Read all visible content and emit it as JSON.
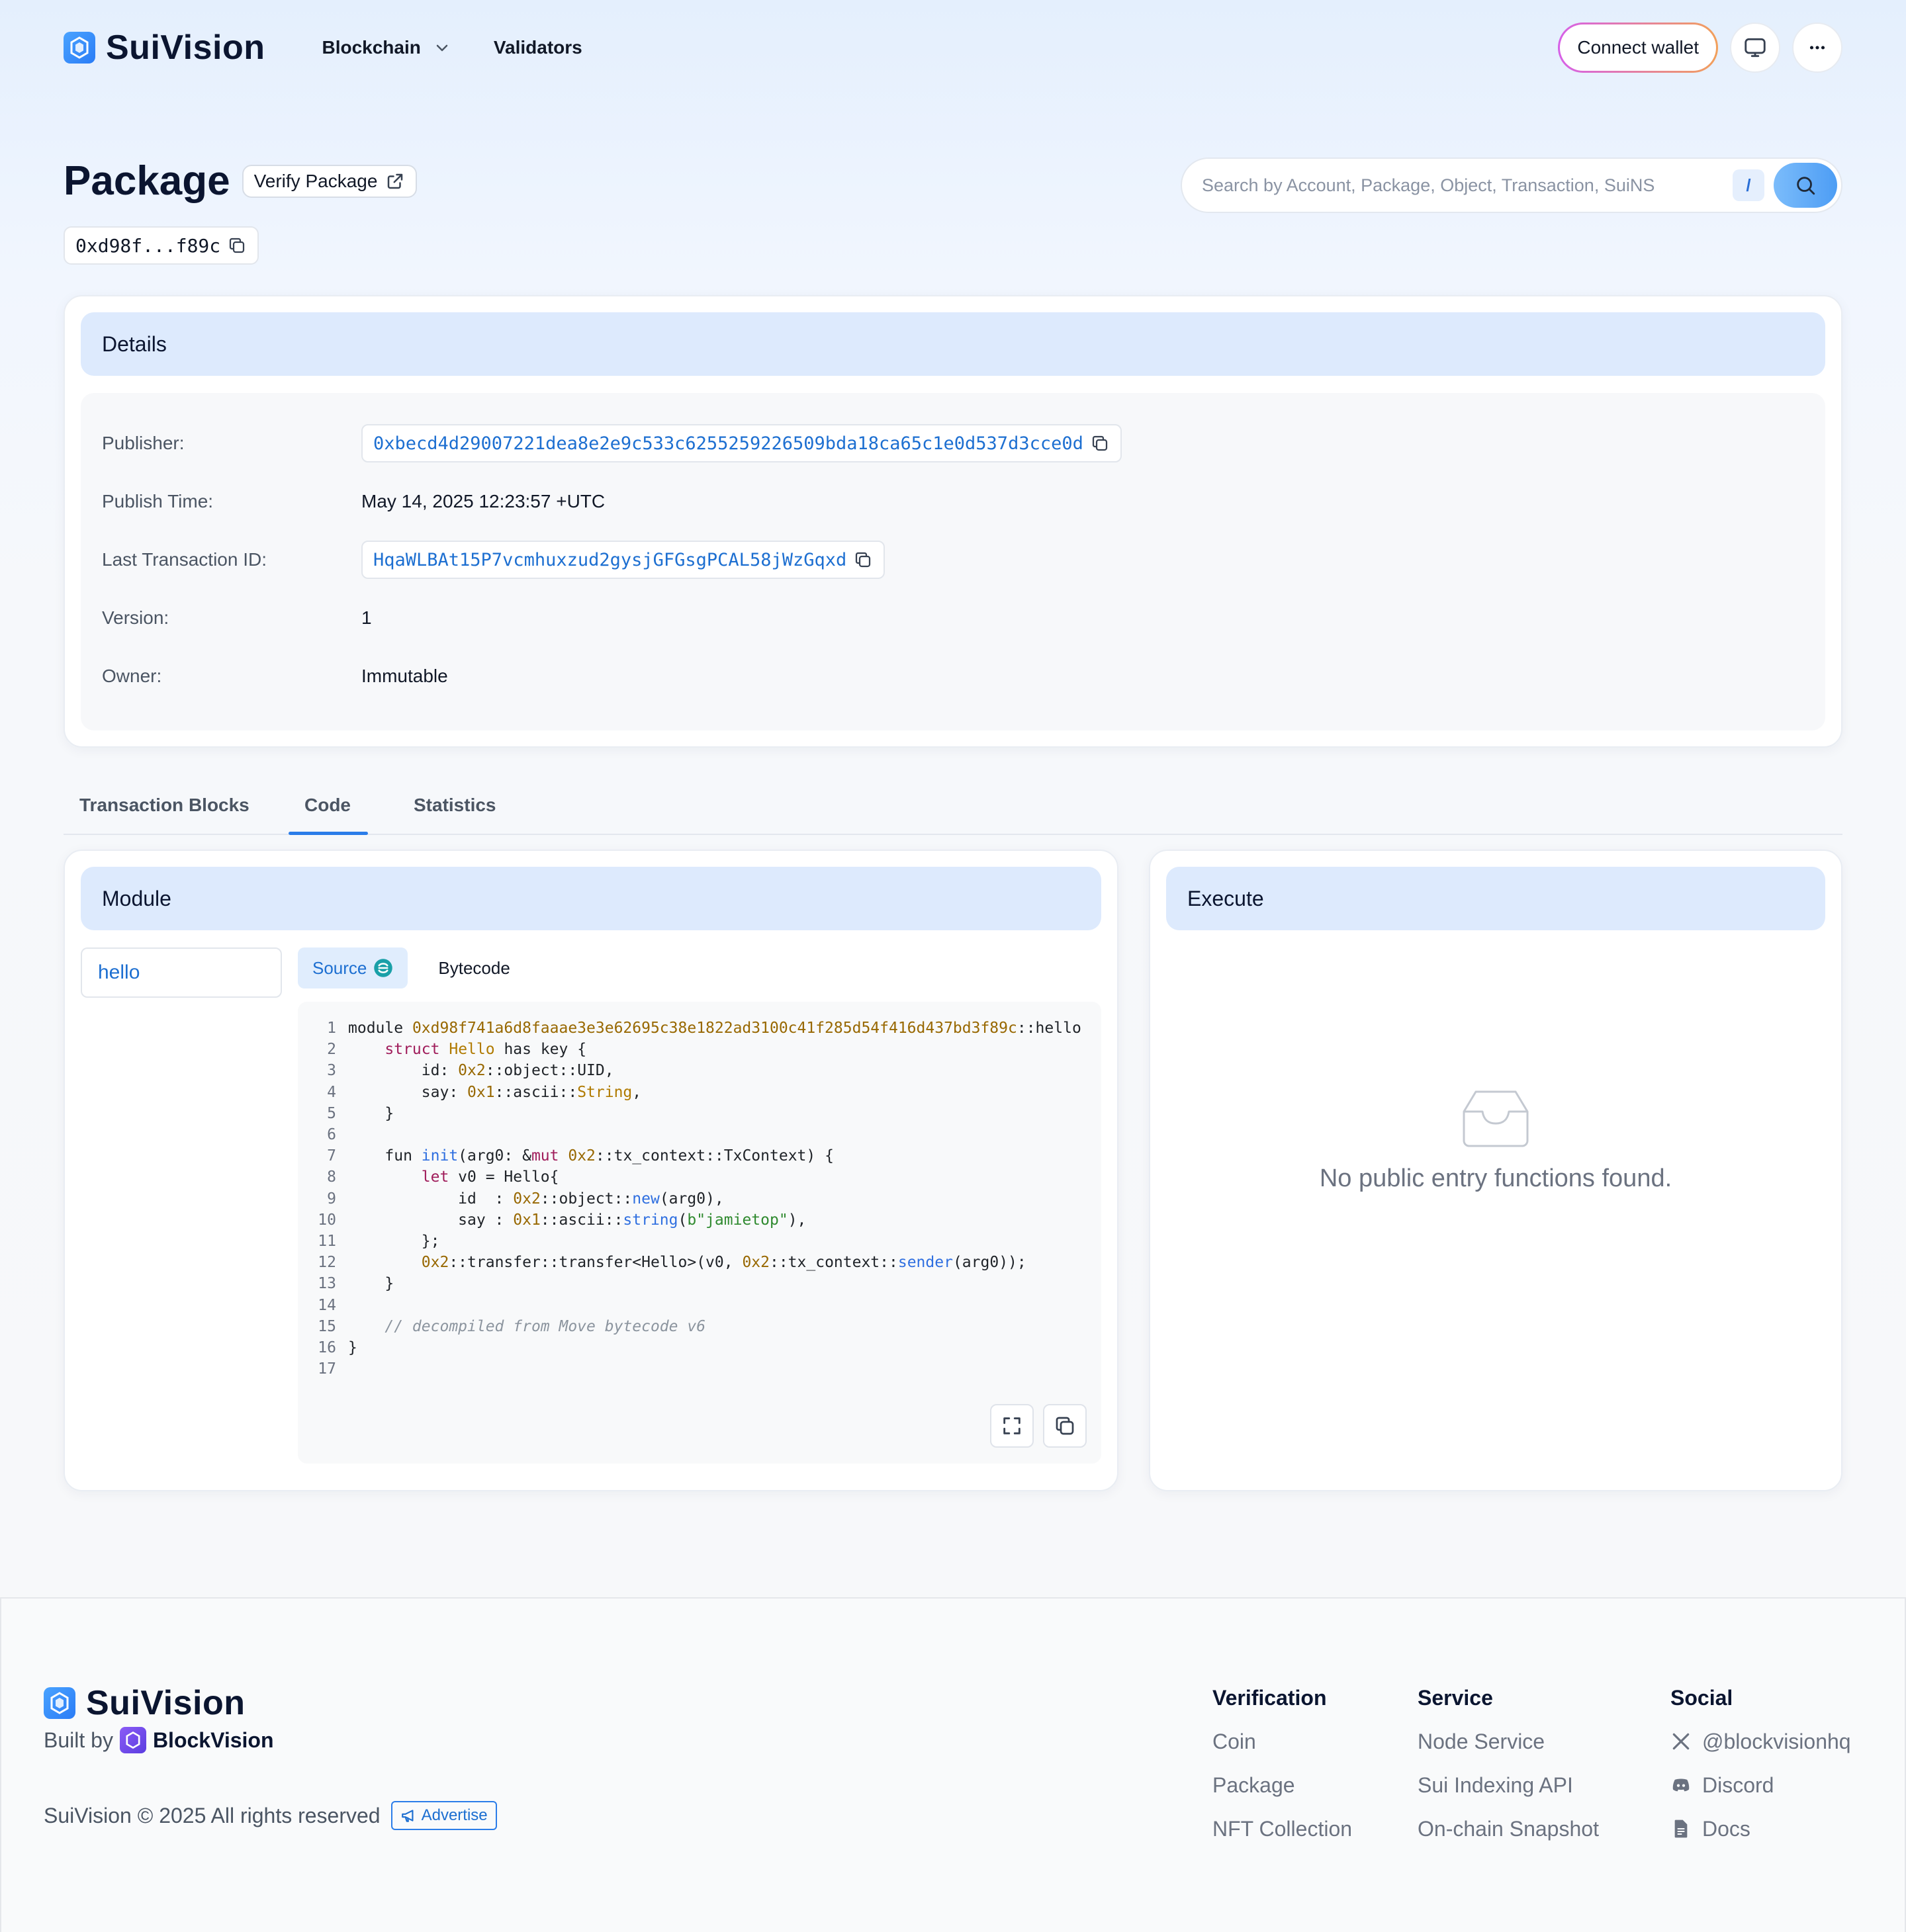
{
  "header": {
    "logo_text": "SuiVision",
    "nav": {
      "blockchain": "Blockchain",
      "validators": "Validators"
    },
    "connect_wallet": "Connect wallet"
  },
  "title": {
    "heading": "Package",
    "verify_label": "Verify Package",
    "short_address": "0xd98f...f89c"
  },
  "search": {
    "placeholder": "Search by Account, Package, Object, Transaction, SuiNS",
    "shortcut": "/"
  },
  "details": {
    "heading": "Details",
    "rows": [
      {
        "label": "Publisher:",
        "value": "0xbecd4d29007221dea8e2e9c533c6255259226509bda18ca65c1e0d537d3cce0d"
      },
      {
        "label": "Publish Time:",
        "value": "May 14, 2025 12:23:57 +UTC"
      },
      {
        "label": "Last Transaction ID:",
        "value": "HqaWLBAt15P7vcmhuxzud2gysjGFGsgPCAL58jWzGqxd"
      },
      {
        "label": "Version:",
        "value": "1"
      },
      {
        "label": "Owner:",
        "value": "Immutable"
      }
    ]
  },
  "tabs": [
    "Transaction Blocks",
    "Code",
    "Statistics"
  ],
  "active_tab": "Code",
  "module": {
    "heading": "Module",
    "items": [
      "hello"
    ],
    "code_tabs": {
      "source": "Source",
      "bytecode": "Bytecode"
    },
    "code_lines": [
      "module 0xd98f741a6d8faaae3e3e62695c38e1822ad3100c41f285d54f416d437bd3f89c::hello",
      "    struct Hello has key {",
      "        id: 0x2::object::UID,",
      "        say: 0x1::ascii::String,",
      "    }",
      "",
      "    fun init(arg0: &mut 0x2::tx_context::TxContext) {",
      "        let v0 = Hello{",
      "            id  : 0x2::object::new(arg0),",
      "            say : 0x1::ascii::string(b\"jamietop\"),",
      "        };",
      "        0x2::transfer::transfer<Hello>(v0, 0x2::tx_context::sender(arg0));",
      "    }",
      "",
      "    // decompiled from Move bytecode v6",
      "}",
      ""
    ]
  },
  "execute": {
    "heading": "Execute",
    "empty_message": "No public entry functions found."
  },
  "footer": {
    "logo_text": "SuiVision",
    "built_by": "Built by",
    "builder": "BlockVision",
    "copyright": "SuiVision © 2025 All rights reserved",
    "advertise": "Advertise",
    "columns": [
      {
        "title": "Verification",
        "links": [
          "Coin",
          "Package",
          "NFT Collection"
        ]
      },
      {
        "title": "Service",
        "links": [
          "Node Service",
          "Sui Indexing API",
          "On-chain Snapshot"
        ]
      },
      {
        "title": "Social",
        "links": [
          "@blockvisionhq",
          "Discord",
          "Docs"
        ]
      }
    ]
  },
  "colors": {
    "accent": "#2b7de9",
    "link": "#1d6fd1",
    "card_head": "#ddeafd"
  }
}
